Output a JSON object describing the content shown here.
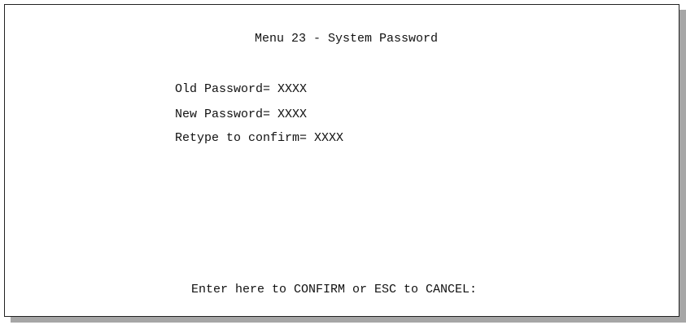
{
  "screen": {
    "title": "Menu 23 - System Password",
    "fields": [
      {
        "label": "Old Password=",
        "value": "XXXX"
      },
      {
        "label": "New Password=",
        "value": "XXXX"
      },
      {
        "label": "Retype to confirm=",
        "value": "XXXX"
      }
    ],
    "prompt": "Enter here to CONFIRM or ESC to CANCEL:"
  },
  "colors": {
    "background": "#ffffff",
    "text": "#111111",
    "border": "#222222",
    "shadow": "#a6a6a6"
  }
}
